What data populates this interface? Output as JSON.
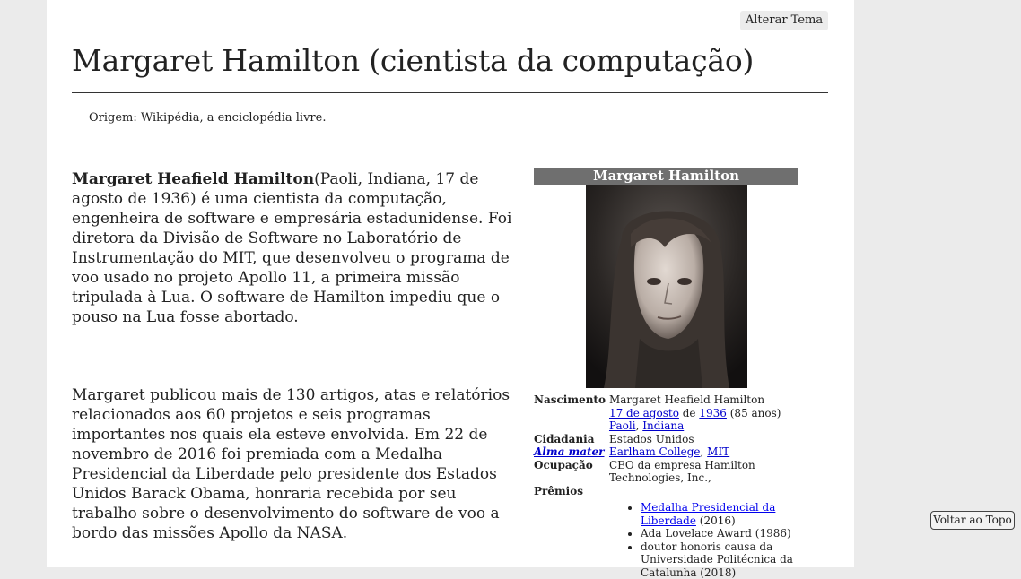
{
  "header": {
    "theme_button": "Alterar Tema",
    "title": "Margaret Hamilton (cientista da computação)",
    "origin": "Origem: Wikipédia, a enciclopédia livre."
  },
  "article": {
    "para1_bold": "Margaret Heafield Hamilton",
    "para1_text": "(Paoli, Indiana, 17 de agosto de 1936) é uma cientista da computação, engenheira de software e empresária estadunidense. Foi diretora da Divisão de Software no Laboratório de Instrumentação do MIT, que desenvolveu o programa de voo usado no projeto Apollo 11, a primeira missão tripulada à Lua. O software de Hamilton impediu que o pouso na Lua fosse abortado.",
    "para2_text": "Margaret publicou mais de 130 artigos, atas e relatórios relacionados aos 60 projetos e seis programas importantes nos quais ela esteve envolvida. Em 22 de novembro de 2016 foi premiada com a Medalha Presidencial da Liberdade pelo presidente dos Estados Unidos Barack Obama, honraria recebida por seu trabalho sobre o desenvolvimento do software de voo a bordo das missões Apollo da NASA."
  },
  "infobox": {
    "title": "Margaret Hamilton",
    "birth_label": "Nascimento",
    "birth_name": "Margaret Heafield Hamilton",
    "birth_date_link": "17 de agosto",
    "birth_de": "de",
    "birth_year_link": "1936",
    "birth_age": "(85 anos)",
    "birth_place_link1": "Paoli",
    "birth_place_sep": ",",
    "birth_place_link2": "Indiana",
    "citizenship_label": "Cidadania",
    "citizenship_value": "Estados Unidos",
    "alma_label": "Alma mater",
    "alma_link1": "Earlham College",
    "alma_sep": ",",
    "alma_link2": "MIT",
    "occupation_label": "Ocupação",
    "occupation_value": "CEO da empresa Hamilton Technologies, Inc.,",
    "awards_label": "Prêmios",
    "award1_link": "Medalha Presidencial da Liberdade",
    "award1_year": "(2016)",
    "award2": "Ada Lovelace Award (1986)",
    "award3": "doutor honoris causa da Universidade Politécnica da Catalunha (2018)"
  },
  "footer": {
    "back_to_top": "Voltar ao Topo"
  }
}
